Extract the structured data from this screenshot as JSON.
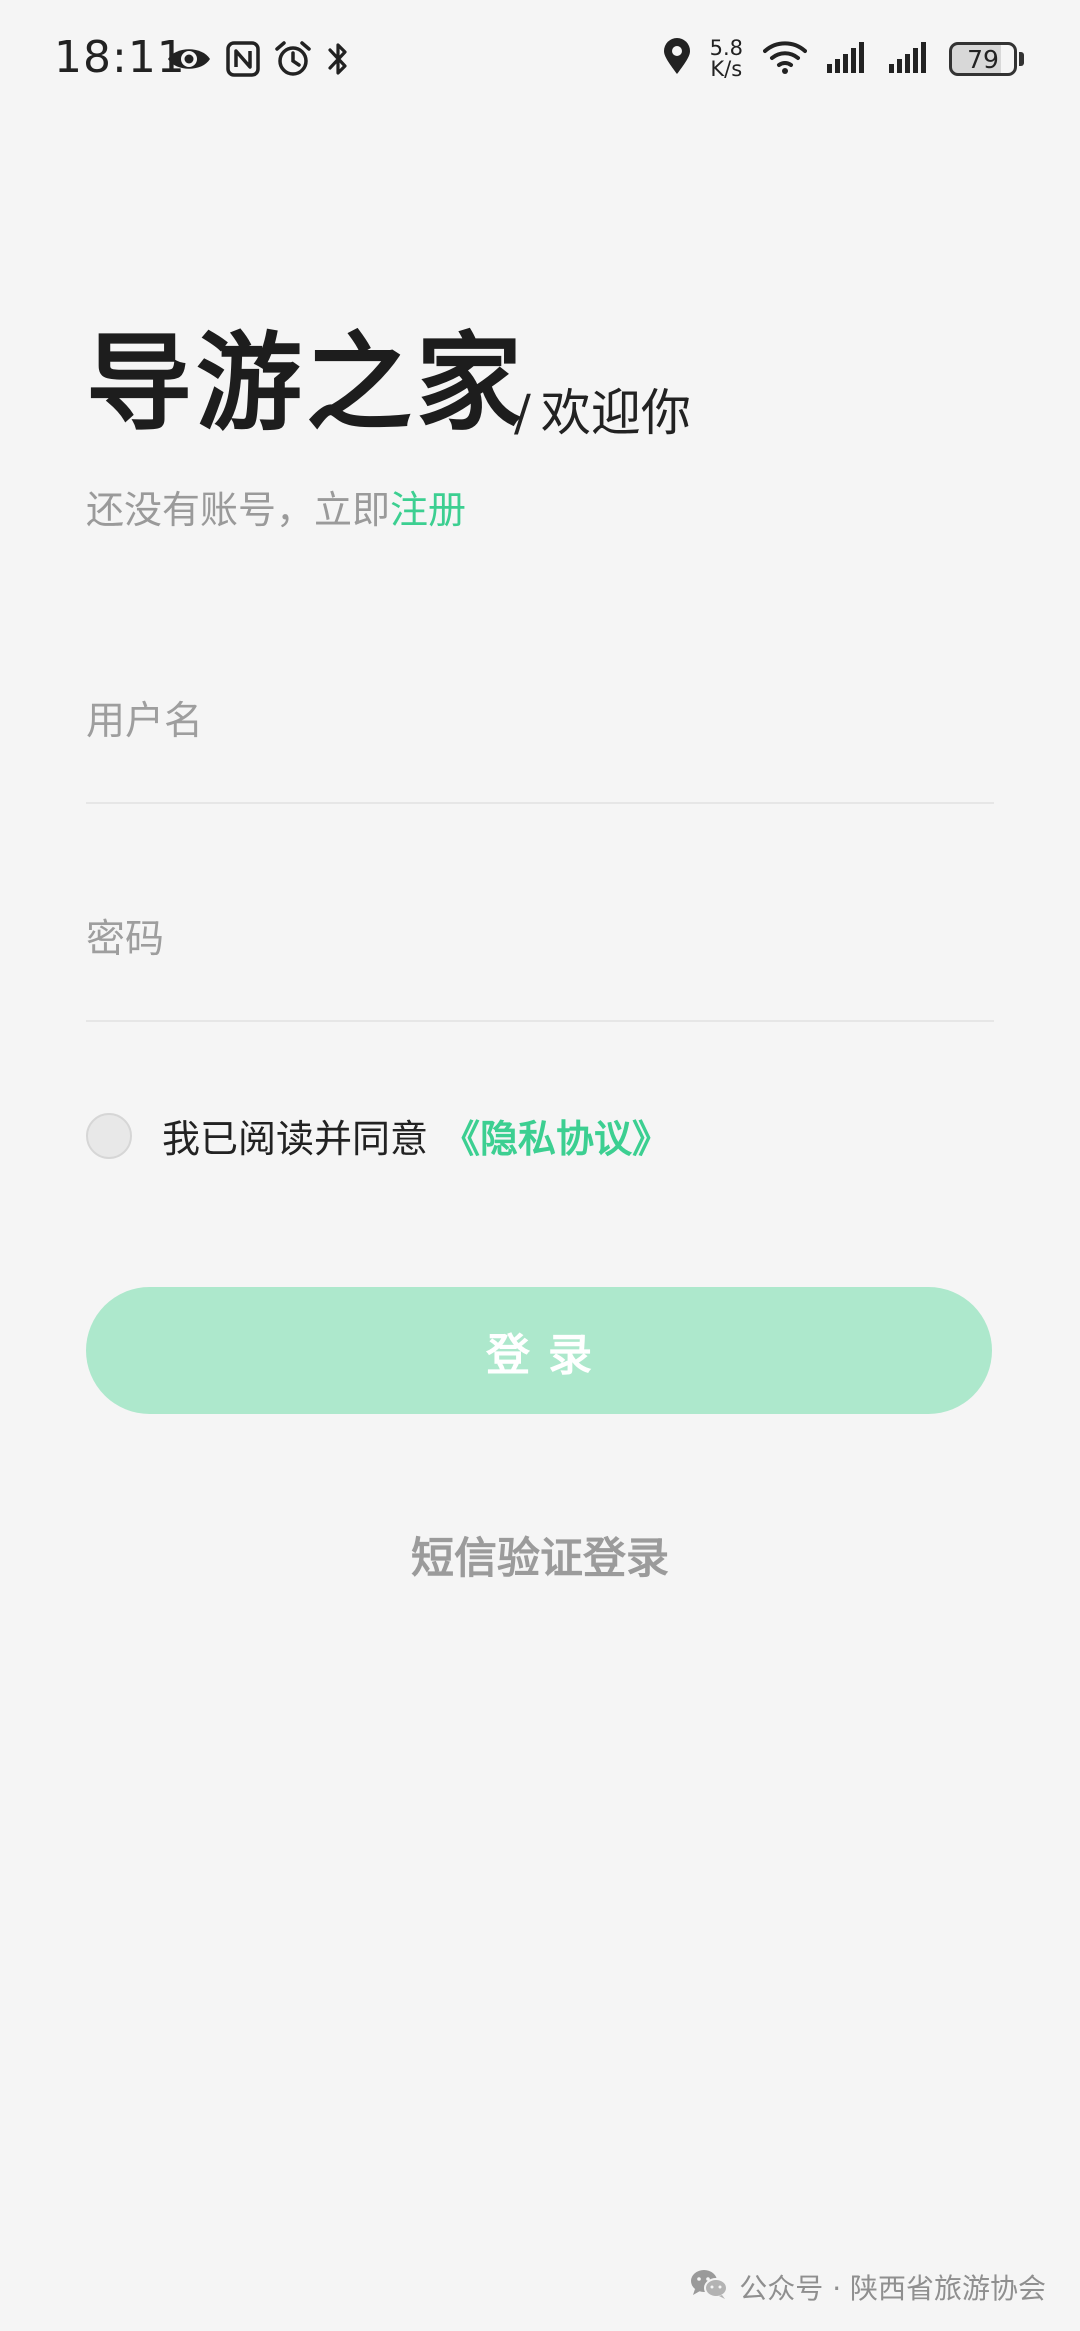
{
  "status_bar": {
    "time": "18:11",
    "network_speed_value": "5.8",
    "network_speed_unit": "K/s",
    "battery_level": "79",
    "left_icons": [
      "eye-icon",
      "nfc-icon",
      "alarm-icon",
      "bluetooth-icon"
    ],
    "right_icons": [
      "location-icon",
      "wifi-icon",
      "signal-icon",
      "signal-icon"
    ]
  },
  "header": {
    "app_title": "导游之家",
    "welcome_slash": "/",
    "welcome_text": "欢迎你",
    "register_prompt": "还没有账号，立即",
    "register_link": "注册"
  },
  "form": {
    "username_placeholder": "用户名",
    "username_value": "",
    "password_placeholder": "密码",
    "password_value": ""
  },
  "agreement": {
    "checked": false,
    "text": "我已阅读并同意",
    "link": "《隐私协议》"
  },
  "actions": {
    "login_label": "登录",
    "sms_login_label": "短信验证登录"
  },
  "watermark": {
    "text": "公众号 · 陕西省旅游协会",
    "icon": "wechat-icon"
  },
  "colors": {
    "accent": "#3ccf91",
    "login_button_bg": "#ade8cc",
    "background": "#f5f5f5",
    "muted_text": "#9a9a9a"
  }
}
